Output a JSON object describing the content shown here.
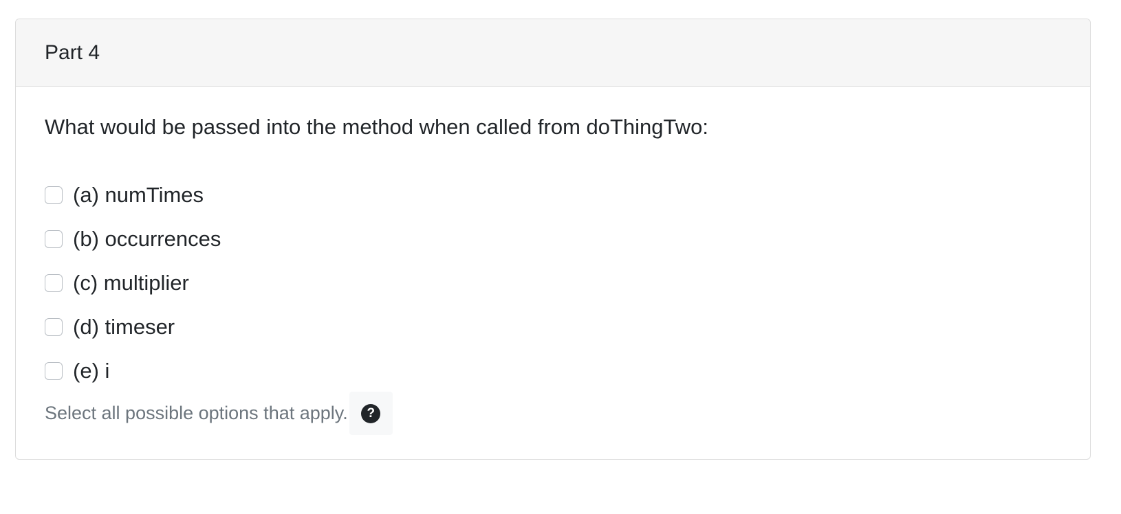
{
  "card": {
    "title": "Part 4"
  },
  "question": {
    "text": "What would be passed into the method when called from doThingTwo:"
  },
  "options": [
    {
      "label": "(a) numTimes",
      "checked": false
    },
    {
      "label": "(b) occurrences",
      "checked": false
    },
    {
      "label": "(c) multiplier",
      "checked": false
    },
    {
      "label": "(d) timeser",
      "checked": false
    },
    {
      "label": "(e) i",
      "checked": false
    }
  ],
  "hint": {
    "text": "Select all possible options that apply.",
    "help_icon_glyph": "?",
    "help_icon": "question-circle-icon"
  }
}
